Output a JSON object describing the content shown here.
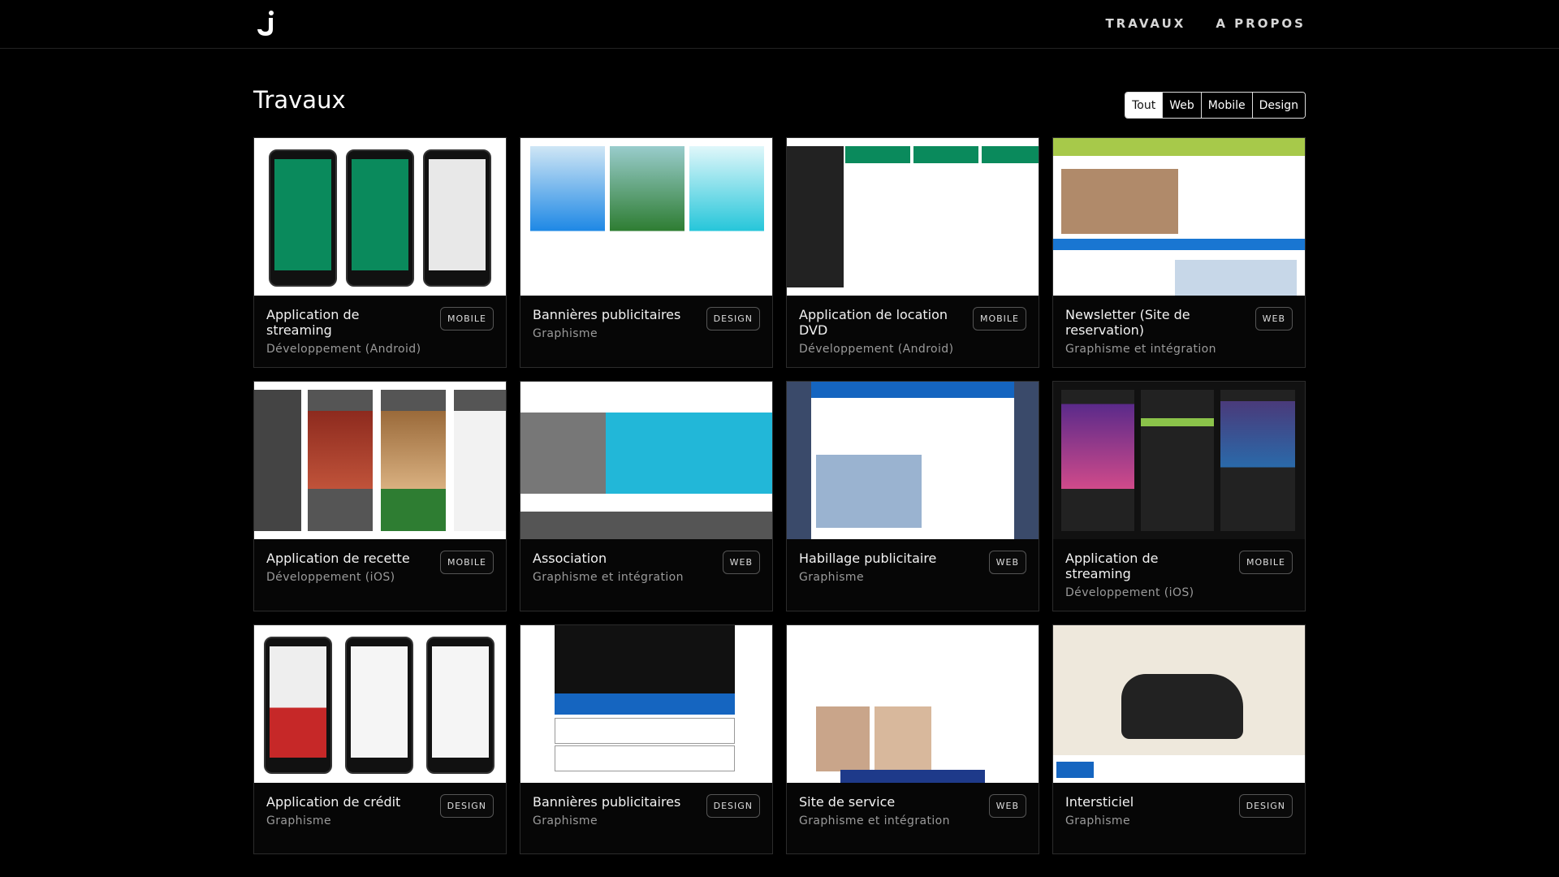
{
  "nav": {
    "links": [
      "TRAVAUX",
      "A PROPOS"
    ]
  },
  "page": {
    "title": "Travaux"
  },
  "filters": {
    "items": [
      "Tout",
      "Web",
      "Mobile",
      "Design"
    ],
    "active": "Tout"
  },
  "cards": [
    {
      "title": "Application de streaming",
      "subtitle": "Développement (Android)",
      "tag": "MOBILE"
    },
    {
      "title": "Bannières publicitaires",
      "subtitle": "Graphisme",
      "tag": "DESIGN"
    },
    {
      "title": "Application de location DVD",
      "subtitle": "Développement (Android)",
      "tag": "MOBILE"
    },
    {
      "title": "Newsletter (Site de reservation)",
      "subtitle": "Graphisme et intégration",
      "tag": "WEB"
    },
    {
      "title": "Application de recette",
      "subtitle": "Développement (iOS)",
      "tag": "MOBILE"
    },
    {
      "title": "Association",
      "subtitle": "Graphisme et intégration",
      "tag": "WEB"
    },
    {
      "title": "Habillage publicitaire",
      "subtitle": "Graphisme",
      "tag": "WEB"
    },
    {
      "title": "Application de streaming",
      "subtitle": "Développement (iOS)",
      "tag": "MOBILE"
    },
    {
      "title": "Application de crédit",
      "subtitle": "Graphisme",
      "tag": "DESIGN"
    },
    {
      "title": "Bannières publicitaires",
      "subtitle": "Graphisme",
      "tag": "DESIGN"
    },
    {
      "title": "Site de service",
      "subtitle": "Graphisme et intégration",
      "tag": "WEB"
    },
    {
      "title": "Intersticiel",
      "subtitle": "Graphisme",
      "tag": "DESIGN"
    }
  ],
  "colors": {
    "background": "#000000",
    "accent_green": "#0a8a5c",
    "tag_border": "#555555"
  }
}
